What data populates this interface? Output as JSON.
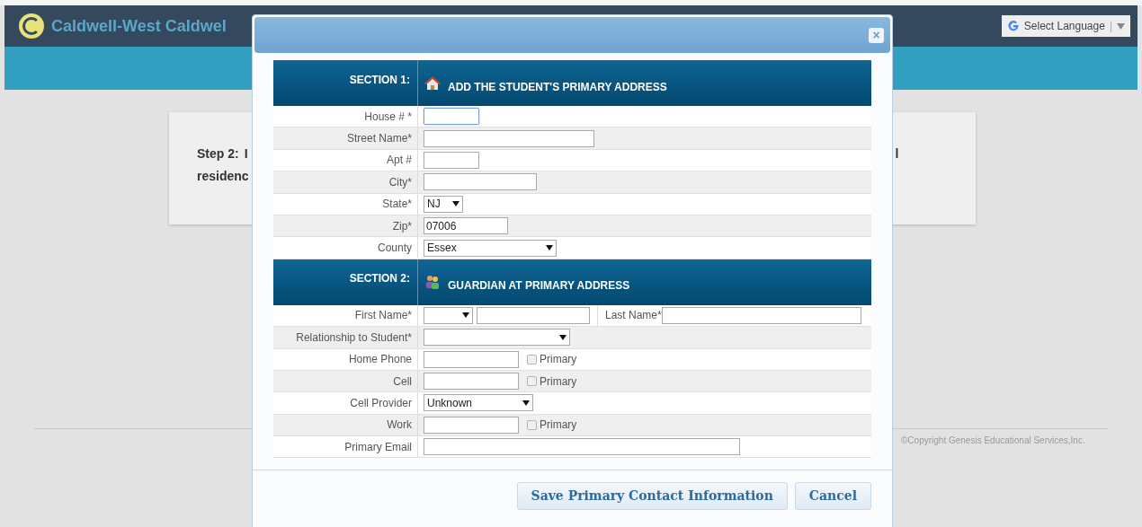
{
  "header": {
    "title": "Caldwell-West Caldwel",
    "language_button": "Select Language",
    "separator": "|"
  },
  "card": {
    "step_label": "Step 2:",
    "step_fragment": "I",
    "second_line": "residenc",
    "right_fragment": "l"
  },
  "footer": {
    "copyright": "©Copyright Genesis Educational Services,Inc."
  },
  "dialog": {
    "close": "×",
    "sections": [
      {
        "label": "SECTION 1:",
        "title": "ADD THE STUDENT'S PRIMARY ADDRESS",
        "kind": "house",
        "rows": [
          {
            "label": "House # *",
            "controls": [
              {
                "kind": "text",
                "focused": true
              }
            ]
          },
          {
            "label": "Street Name*",
            "controls": [
              {
                "kind": "text",
                "focused": false
              }
            ]
          },
          {
            "label": "Apt #",
            "controls": [
              {
                "kind": "text",
                "focused": false
              }
            ]
          },
          {
            "label": "City*",
            "controls": [
              {
                "kind": "text",
                "focused": false
              }
            ]
          },
          {
            "label": "State*",
            "controls": [
              {
                "kind": "select",
                "value": "NJ"
              }
            ]
          },
          {
            "label": "Zip*",
            "controls": [
              {
                "kind": "text",
                "value": "07006",
                "focused": false
              }
            ]
          },
          {
            "label": "County",
            "controls": [
              {
                "kind": "select",
                "value": "Essex"
              }
            ]
          }
        ]
      },
      {
        "label": "SECTION 2:",
        "title": "GUARDIAN AT PRIMARY ADDRESS",
        "kind": "people",
        "rows": [
          {
            "label": "First Name*",
            "controls": [
              {
                "kind": "select"
              },
              {
                "kind": "text",
                "focused": false
              },
              {
                "kind": "label",
                "text": "Last Name*"
              },
              {
                "kind": "text",
                "focused": false
              }
            ]
          },
          {
            "label": "Relationship to Student*",
            "controls": [
              {
                "kind": "select"
              }
            ]
          },
          {
            "label": "Home Phone",
            "controls": [
              {
                "kind": "text",
                "focused": false
              },
              {
                "kind": "checkbox",
                "text": "Primary",
                "checked": false
              }
            ]
          },
          {
            "label": "Cell",
            "controls": [
              {
                "kind": "text",
                "focused": false
              },
              {
                "kind": "checkbox",
                "text": "Primary",
                "checked": false
              }
            ]
          },
          {
            "label": "Cell Provider",
            "controls": [
              {
                "kind": "select",
                "value": "Unknown"
              }
            ]
          },
          {
            "label": "Work",
            "controls": [
              {
                "kind": "text",
                "focused": false
              },
              {
                "kind": "checkbox",
                "text": "Primary",
                "checked": false
              }
            ]
          },
          {
            "label": "Primary Email",
            "controls": [
              {
                "kind": "text",
                "focused": false
              }
            ]
          }
        ]
      }
    ],
    "buttons": [
      "Save Primary Contact Information",
      "Cancel"
    ]
  }
}
